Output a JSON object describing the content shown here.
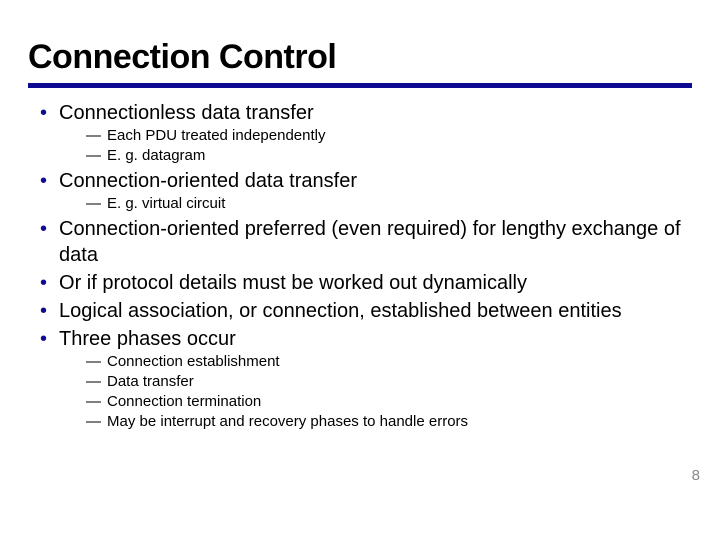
{
  "title": "Connection Control",
  "page_number": "8",
  "items": [
    {
      "level": 1,
      "text": "Connectionless data transfer"
    },
    {
      "level": 2,
      "text": "Each PDU treated independently"
    },
    {
      "level": 2,
      "text": "E. g. datagram"
    },
    {
      "level": 1,
      "text": "Connection-oriented data transfer"
    },
    {
      "level": 2,
      "text": "E. g. virtual circuit"
    },
    {
      "level": 1,
      "text": "Connection-oriented preferred (even required) for lengthy exchange of data"
    },
    {
      "level": 1,
      "text": "Or if protocol details must be worked out dynamically"
    },
    {
      "level": 1,
      "text": "Logical association, or connection, established between entities"
    },
    {
      "level": 1,
      "text": "Three phases occur"
    },
    {
      "level": 2,
      "text": "Connection establishment"
    },
    {
      "level": 2,
      "text": "Data transfer"
    },
    {
      "level": 2,
      "text": "Connection termination"
    },
    {
      "level": 2,
      "text": "May be interrupt and recovery phases to handle errors"
    }
  ]
}
